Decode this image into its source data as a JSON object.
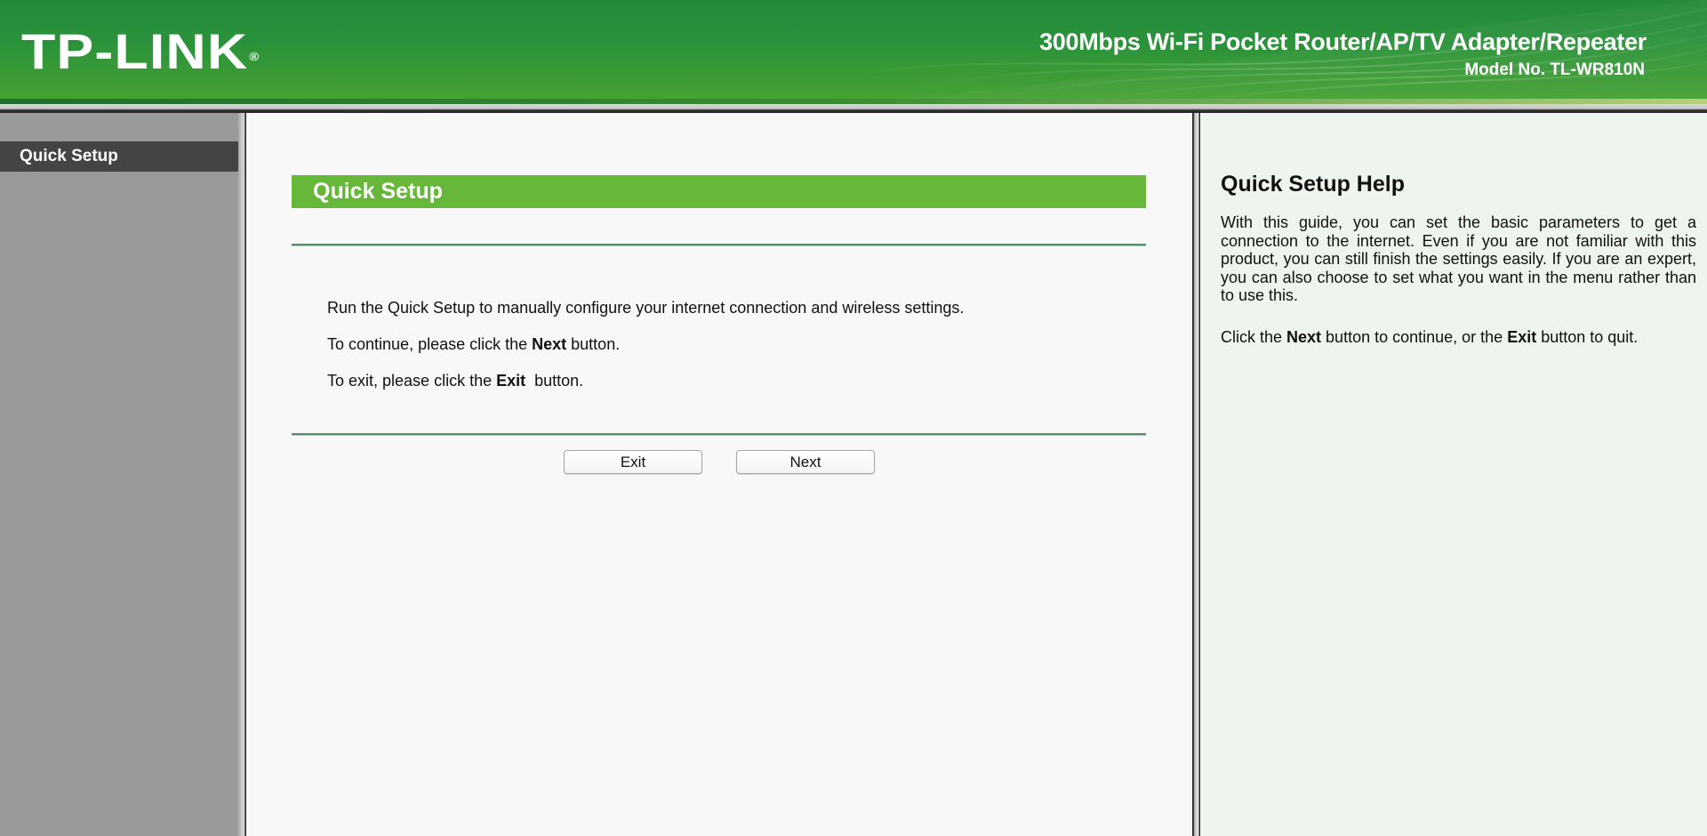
{
  "header": {
    "logo_text": "TP-LINK",
    "logo_reg": "®",
    "product_title": "300Mbps Wi-Fi Pocket Router/AP/TV Adapter/Repeater",
    "model_no": "Model No. TL-WR810N"
  },
  "sidebar": {
    "items": [
      {
        "label": "Quick Setup",
        "active": true
      }
    ]
  },
  "main": {
    "section_title": "Quick Setup",
    "para1": "Run the Quick Setup to manually configure your internet connection and wireless settings.",
    "para2_pre": "To continue, please click the ",
    "para2_bold": "Next",
    "para2_post": " button.",
    "para3_pre": "To exit, please click the ",
    "para3_bold": "Exit",
    "para3_post": "  button.",
    "exit_label": "Exit",
    "next_label": "Next"
  },
  "help": {
    "title": "Quick Setup Help",
    "text1": "With this guide, you can set the basic parameters to get a connection to the internet. Even if you are not familiar with this product, you can still finish the settings easily. If you are an expert, you can also choose to set what you want in the menu rather than to use this.",
    "text2_a": "Click the ",
    "text2_b": "Next",
    "text2_c": " button to continue, or the ",
    "text2_d": "Exit",
    "text2_e": " button to quit."
  },
  "colors": {
    "header_green": "#2a923b",
    "section_green": "#67b83a",
    "sidebar_gray": "#9a9a9a",
    "sidebar_active": "#444444",
    "help_bg": "#edf5ee"
  }
}
